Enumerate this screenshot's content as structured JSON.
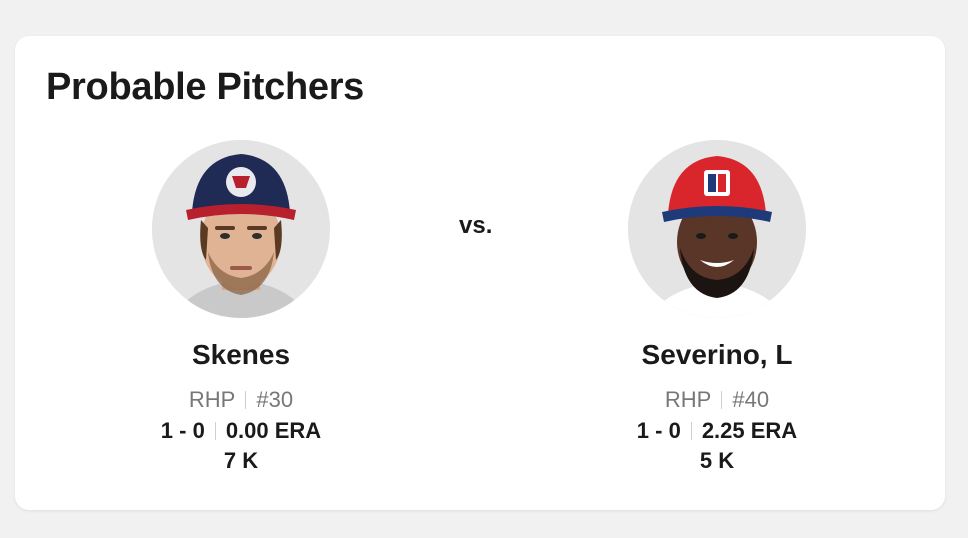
{
  "card": {
    "title": "Probable Pitchers",
    "vs_label": "vs."
  },
  "pitchers": [
    {
      "name": "Skenes",
      "hand": "RHP",
      "number": "#30",
      "record": "1 - 0",
      "era": "0.00 ERA",
      "strikeouts": "7 K",
      "photo": "player-headshot-usa-cap",
      "cap_color": "#1f2a55",
      "cap_brim_color": "#b8202e"
    },
    {
      "name": "Severino, L",
      "hand": "RHP",
      "number": "#40",
      "record": "1 - 0",
      "era": "2.25 ERA",
      "strikeouts": "5 K",
      "photo": "player-headshot-dr-cap",
      "cap_color": "#d8262c",
      "cap_brim_color": "#1f3a7a"
    }
  ]
}
